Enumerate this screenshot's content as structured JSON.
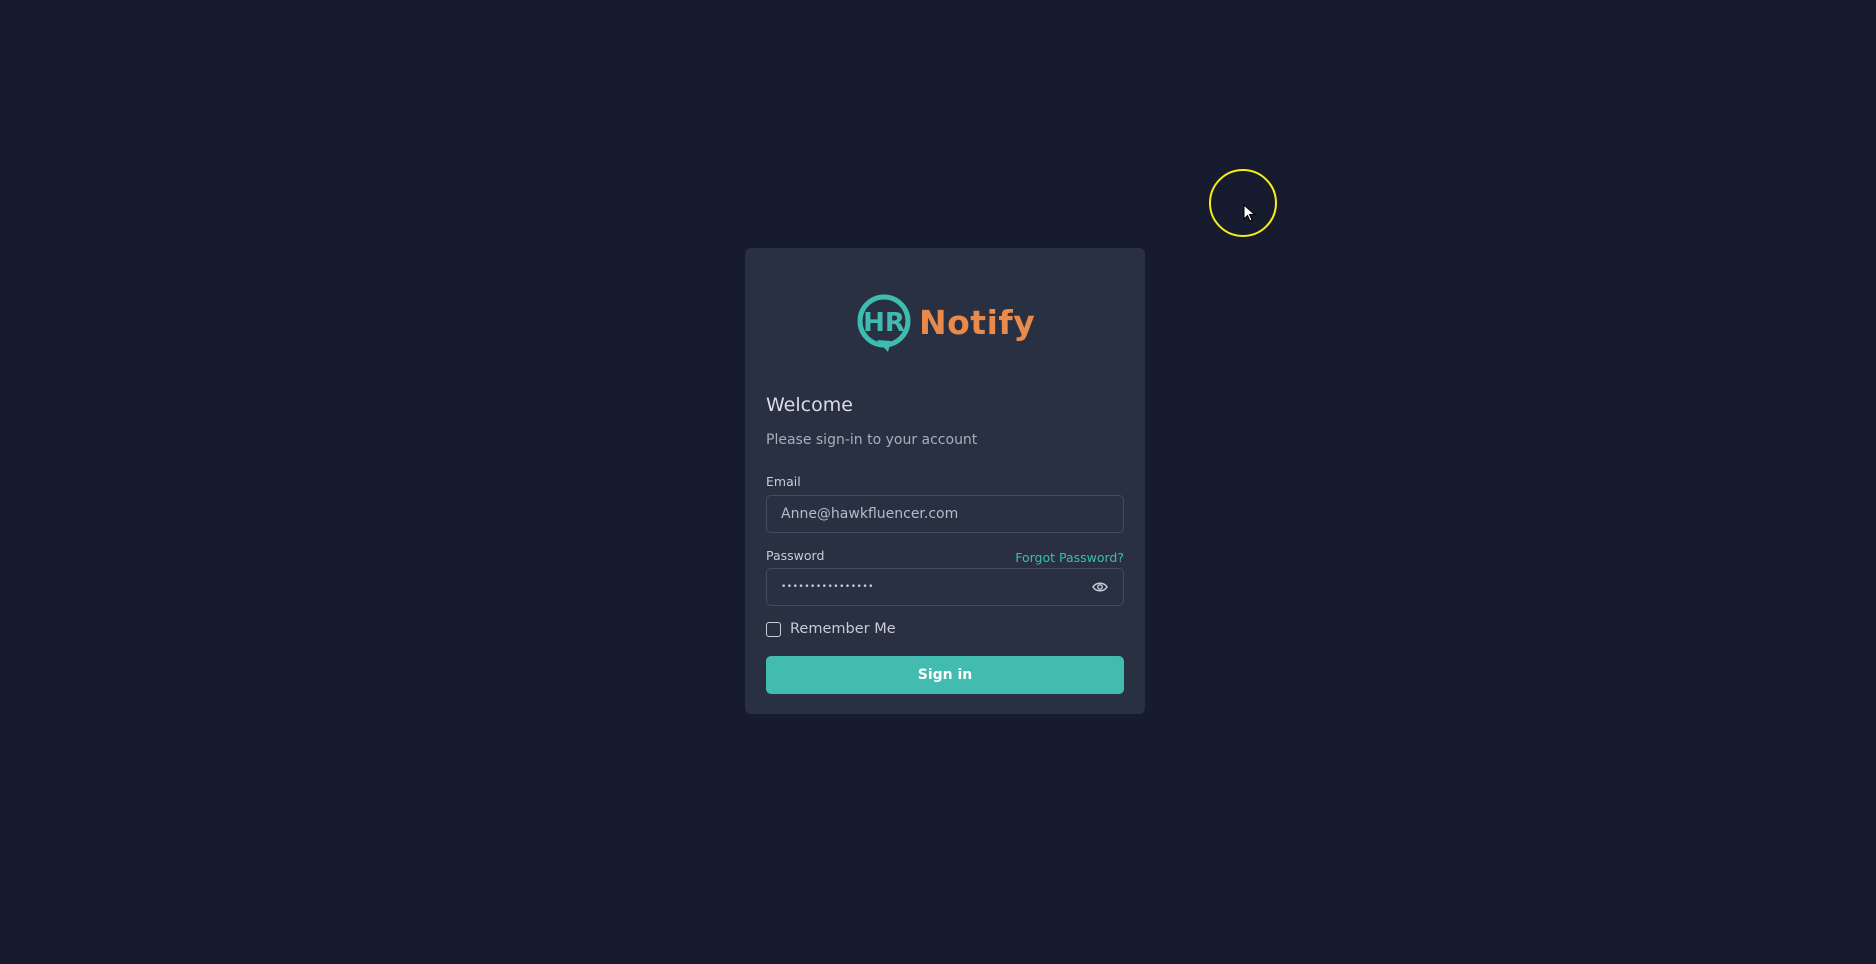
{
  "app": {
    "logo_text": "Notify",
    "logo_mark": "HR"
  },
  "login": {
    "title": "Welcome",
    "subtitle": "Please sign-in to your account",
    "email_label": "Email",
    "email_value": "Anne@hawkfluencer.com",
    "password_label": "Password",
    "password_value": "••••••••••••••••",
    "forgot_label": "Forgot Password?",
    "remember_label": "Remember Me",
    "remember_checked": false,
    "signin_label": "Sign in"
  },
  "icons": {
    "logo": "hr-logo-icon",
    "password_toggle": "eye-icon",
    "cursor": "mouse-pointer-icon"
  },
  "colors": {
    "background": "#161b2e",
    "card": "#283042",
    "accent": "#43bcb0",
    "brand_orange": "#e88a4c",
    "cursor_highlight": "#f4ec1c"
  }
}
